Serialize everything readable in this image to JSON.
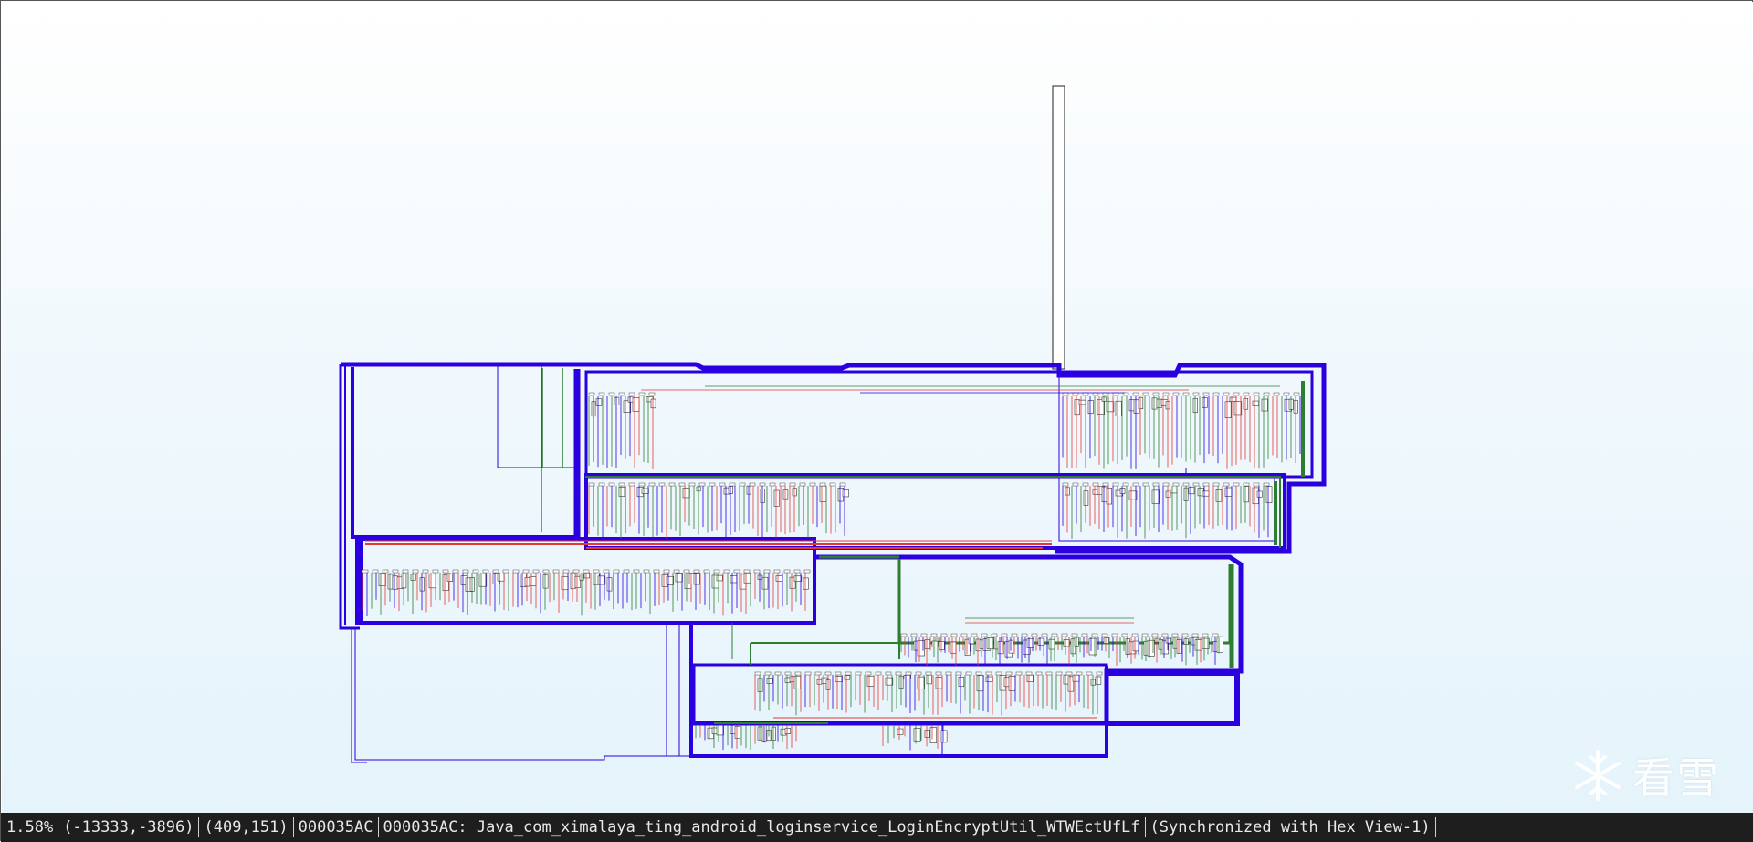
{
  "view": {
    "name": "IDA View graph overview",
    "colors": {
      "background_top": "#ffffff",
      "background_bottom": "#e5f3fb",
      "edge_flow": "#2a00e0",
      "edge_true": "#2e7d32",
      "edge_false": "#e53935",
      "block_border": "#333333",
      "status_bg": "#1e1e1e",
      "status_text": "#e8e8e8"
    }
  },
  "status": {
    "zoom": "1.58%",
    "mouse_coords": "(-13333,-3896)",
    "block_coords": "(409,151)",
    "address": "000035AC",
    "location": "000035AC: Java_com_ximalaya_ting_android_loginservice_LoginEncryptUtil_WTWEctUfLf",
    "sync": "(Synchronized with Hex View-1)"
  },
  "watermark": {
    "icon": "snowflake-icon",
    "text": "看雪"
  }
}
